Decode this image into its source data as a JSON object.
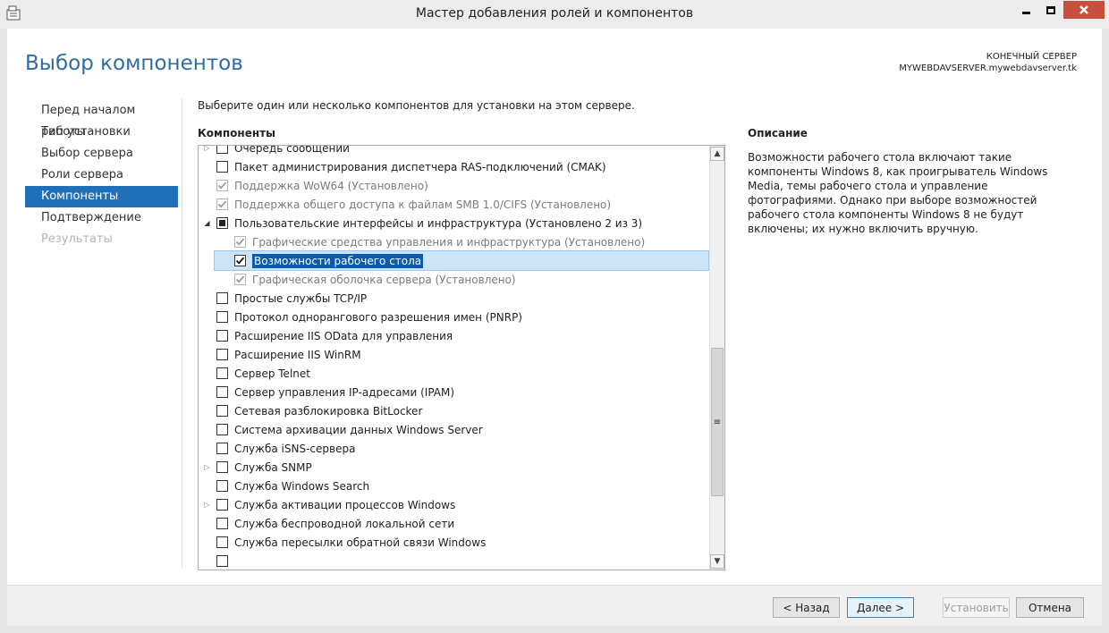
{
  "window": {
    "title": "Мастер добавления ролей и компонентов",
    "close_color": "#c74f3b"
  },
  "page": {
    "title": "Выбор компонентов",
    "destination_label": "КОНЕЧНЫЙ СЕРВЕР",
    "destination_server": "MYWEBDAVSERVER.mywebdavserver.tk"
  },
  "nav": {
    "items": [
      {
        "label": "Перед началом работы",
        "state": "normal"
      },
      {
        "label": "Тип установки",
        "state": "normal"
      },
      {
        "label": "Выбор сервера",
        "state": "normal"
      },
      {
        "label": "Роли сервера",
        "state": "normal"
      },
      {
        "label": "Компоненты",
        "state": "active"
      },
      {
        "label": "Подтверждение",
        "state": "normal"
      },
      {
        "label": "Результаты",
        "state": "disabled"
      }
    ],
    "active_color": "#1f6fb9"
  },
  "main": {
    "intro": "Выберите один или несколько компонентов для установки на этом сервере.",
    "components_header": "Компоненты",
    "features": [
      {
        "label": "Очередь сообщений",
        "expander": "collapsed",
        "check": "unchecked",
        "indent": 0
      },
      {
        "label": "Пакет администрирования диспетчера RAS-подключений (CMAK)",
        "expander": "none",
        "check": "unchecked",
        "indent": 0
      },
      {
        "label": "Поддержка WoW64 (Установлено)",
        "expander": "none",
        "check": "checked-disabled",
        "indent": 0
      },
      {
        "label": "Поддержка общего доступа к файлам SMB 1.0/CIFS (Установлено)",
        "expander": "none",
        "check": "checked-disabled",
        "indent": 0
      },
      {
        "label": "Пользовательские интерфейсы и инфраструктура (Установлено 2 из 3)",
        "expander": "expanded",
        "check": "partial",
        "indent": 0
      },
      {
        "label": "Графические средства управления и инфраструктура (Установлено)",
        "expander": "none",
        "check": "checked-disabled",
        "indent": 1
      },
      {
        "label": "Возможности рабочего стола",
        "expander": "none",
        "check": "checked",
        "indent": 1,
        "selected": true
      },
      {
        "label": "Графическая оболочка сервера (Установлено)",
        "expander": "none",
        "check": "checked-disabled",
        "indent": 1
      },
      {
        "label": "Простые службы TCP/IP",
        "expander": "none",
        "check": "unchecked",
        "indent": 0
      },
      {
        "label": "Протокол однорангового разрешения имен (PNRP)",
        "expander": "none",
        "check": "unchecked",
        "indent": 0
      },
      {
        "label": "Расширение IIS OData для управления",
        "expander": "none",
        "check": "unchecked",
        "indent": 0
      },
      {
        "label": "Расширение IIS WinRM",
        "expander": "none",
        "check": "unchecked",
        "indent": 0
      },
      {
        "label": "Сервер Telnet",
        "expander": "none",
        "check": "unchecked",
        "indent": 0
      },
      {
        "label": "Сервер управления IP-адресами (IPAM)",
        "expander": "none",
        "check": "unchecked",
        "indent": 0
      },
      {
        "label": "Сетевая разблокировка BitLocker",
        "expander": "none",
        "check": "unchecked",
        "indent": 0
      },
      {
        "label": "Система архивации данных Windows Server",
        "expander": "none",
        "check": "unchecked",
        "indent": 0
      },
      {
        "label": "Служба iSNS-сервера",
        "expander": "none",
        "check": "unchecked",
        "indent": 0
      },
      {
        "label": "Служба SNMP",
        "expander": "collapsed",
        "check": "unchecked",
        "indent": 0
      },
      {
        "label": "Служба Windows Search",
        "expander": "none",
        "check": "unchecked",
        "indent": 0
      },
      {
        "label": "Служба активации процессов Windows",
        "expander": "collapsed",
        "check": "unchecked",
        "indent": 0
      },
      {
        "label": "Служба беспроводной локальной сети",
        "expander": "none",
        "check": "unchecked",
        "indent": 0
      },
      {
        "label": "Служба пересылки обратной связи Windows",
        "expander": "none",
        "check": "unchecked",
        "indent": 0
      },
      {
        "label": "",
        "expander": "none",
        "check": "unchecked",
        "indent": 0
      }
    ],
    "selection_color": "#0f5aa8"
  },
  "description": {
    "header": "Описание",
    "text": "Возможности рабочего стола включают такие компоненты Windows 8, как проигрыватель Windows Media, темы рабочего стола и управление фотографиями. Однако при выборе возможностей рабочего стола компоненты Windows 8 не будут включены; их нужно включить вручную."
  },
  "footer": {
    "back_label": "< Назад",
    "next_label": "Далее >",
    "install_label": "Установить",
    "cancel_label": "Отмена"
  }
}
